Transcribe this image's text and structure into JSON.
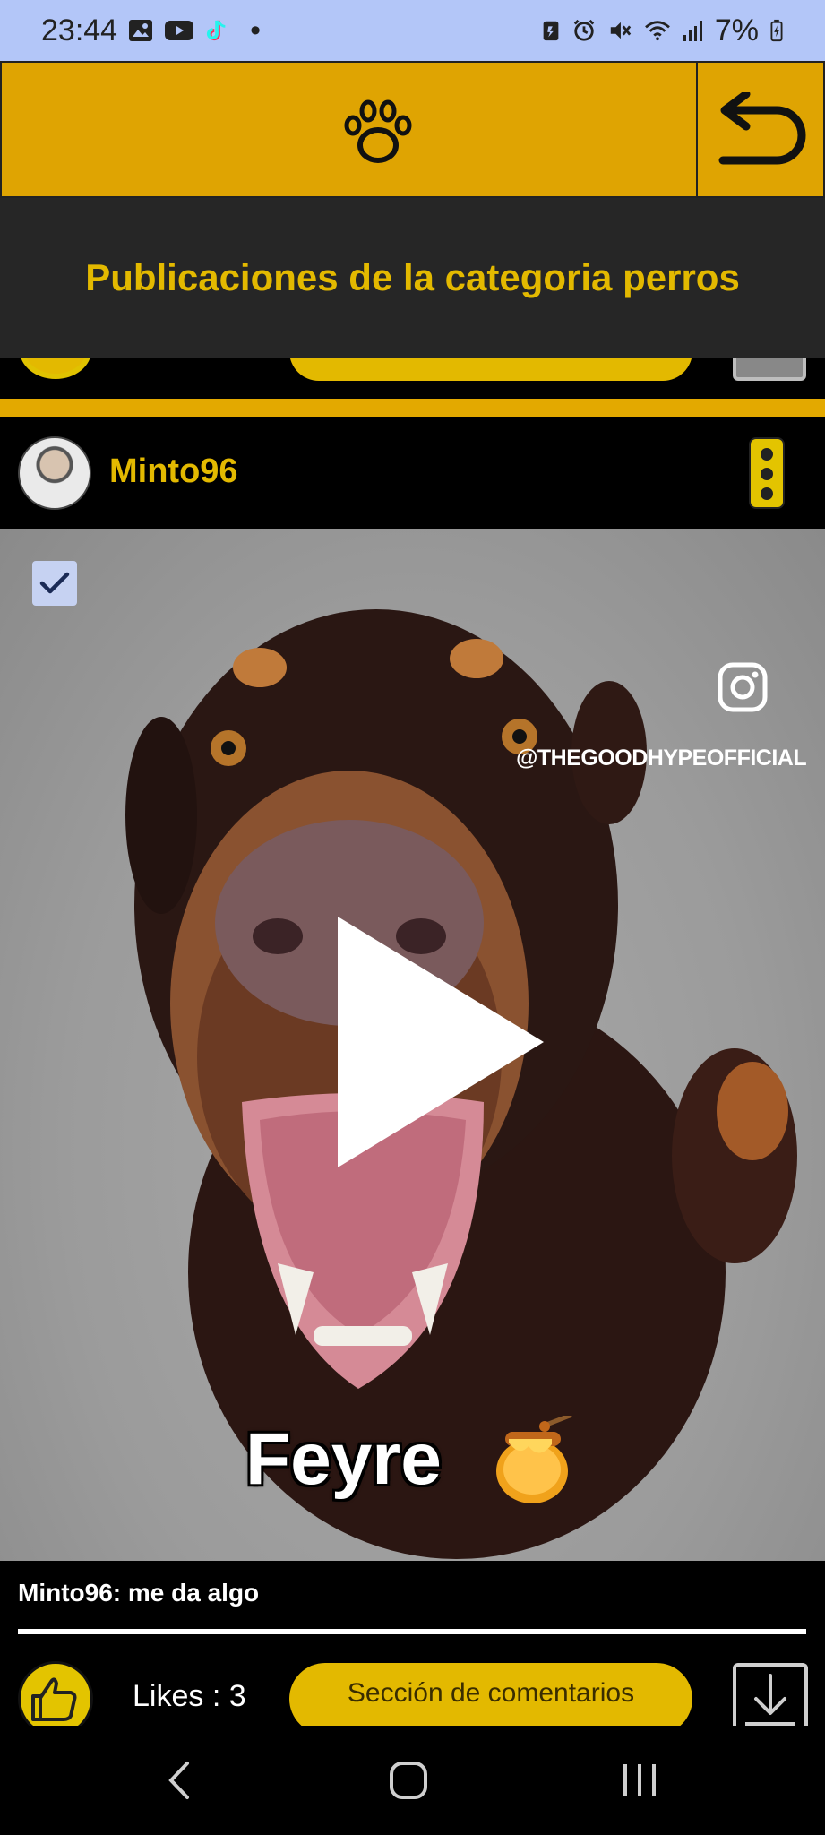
{
  "status_bar": {
    "time": "23:44",
    "dot": "•",
    "battery": "7%",
    "left_icons": [
      "gallery-icon",
      "youtube-icon",
      "tiktok-icon"
    ],
    "right_icons": [
      "data-saver-icon",
      "alarm-icon",
      "mute-icon",
      "wifi-icon",
      "signal-icon",
      "battery-icon"
    ]
  },
  "header": {
    "logo_icon": "paw-icon",
    "back_icon": "back-arrow-icon"
  },
  "banner": {
    "title": "Publicaciones de la categoria perros"
  },
  "post": {
    "username": "Minto96",
    "media": {
      "watermark": "@THEGOODHYPEOFFICIAL",
      "overlay_caption": "Feyre",
      "overlay_emoji_icon": "honey-pot-icon",
      "play_icon": "play-icon",
      "selected": true
    },
    "caption": "Minto96: me da algo",
    "likes_label": "Likes : 3",
    "comments_button": "Sección de comentarios"
  },
  "colors": {
    "accent": "#e3b900",
    "header_bg": "#dfa402",
    "banner_bg": "#262626",
    "status_bg": "#b3c6f8"
  }
}
